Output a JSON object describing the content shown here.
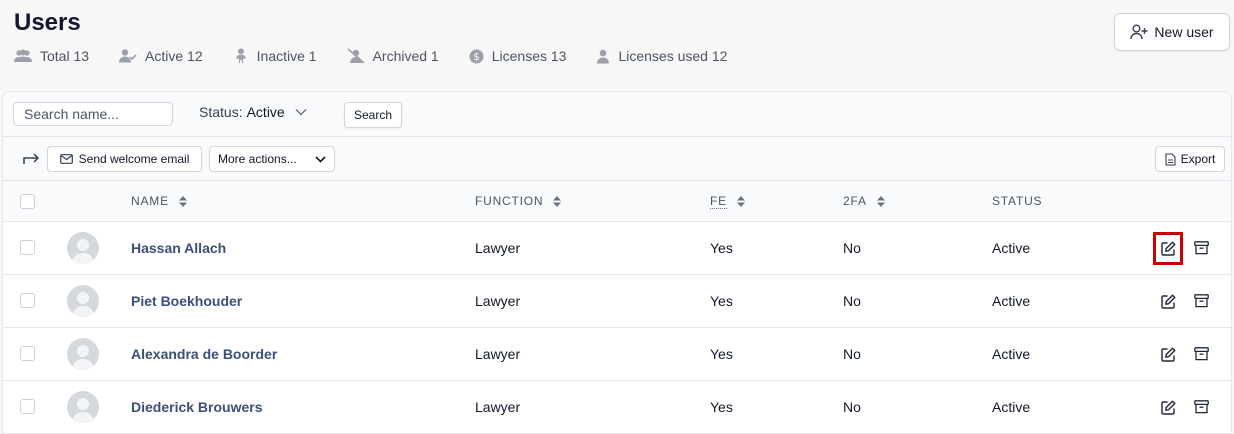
{
  "page": {
    "title": "Users",
    "new_user_label": "New user"
  },
  "stats": [
    {
      "icon": "users-icon",
      "label": "Total 13"
    },
    {
      "icon": "user-check-icon",
      "label": "Active 12"
    },
    {
      "icon": "user-inactive-icon",
      "label": "Inactive 1"
    },
    {
      "icon": "user-slash-icon",
      "label": "Archived 1"
    },
    {
      "icon": "dollar-circle-icon",
      "label": "Licenses 13"
    },
    {
      "icon": "user-icon",
      "label": "Licenses used 12"
    }
  ],
  "filters": {
    "search_placeholder": "Search name...",
    "status_label": "Status:",
    "status_value": "Active",
    "search_button": "Search"
  },
  "bulk_actions": {
    "welcome_email": "Send welcome email",
    "more_actions": "More actions...",
    "export": "Export"
  },
  "table": {
    "columns": {
      "name": "NAME",
      "function": "FUNCTION",
      "fe": "FE",
      "twofa": "2FA",
      "status": "STATUS"
    },
    "rows": [
      {
        "name": "Hassan Allach",
        "function": "Lawyer",
        "fe": "Yes",
        "twofa": "No",
        "status": "Active"
      },
      {
        "name": "Piet Boekhouder",
        "function": "Lawyer",
        "fe": "Yes",
        "twofa": "No",
        "status": "Active"
      },
      {
        "name": "Alexandra de Boorder",
        "function": "Lawyer",
        "fe": "Yes",
        "twofa": "No",
        "status": "Active"
      },
      {
        "name": "Diederick Brouwers",
        "function": "Lawyer",
        "fe": "Yes",
        "twofa": "No",
        "status": "Active"
      }
    ]
  },
  "colors": {
    "title": "#0f1733",
    "link": "#3b4f7a",
    "highlight": "#cc0000"
  }
}
